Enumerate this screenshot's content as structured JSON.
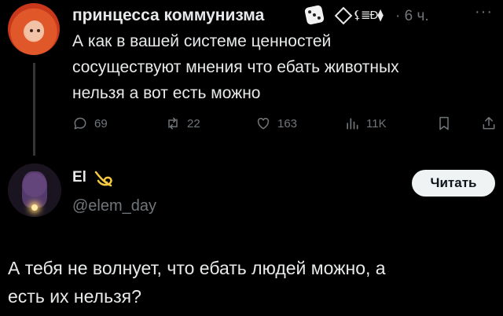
{
  "tweet1": {
    "author_name": "принцесса коммунизма",
    "badge_text": "⚸≣Ð⧫",
    "time": "· 6 ч.",
    "more": "···",
    "text_lines": [
      "А как в вашей системе ценностей",
      "сосуществуют мнения что ебать животных",
      "нельзя а вот есть можно"
    ],
    "stats": {
      "replies": "69",
      "retweets": "22",
      "likes": "163",
      "views": "11K"
    }
  },
  "reply": {
    "author_name": "El",
    "handle": "@elem_day",
    "follow_label": "Читать",
    "text_lines": [
      "А тебя не волнует, что ебать людей можно, а",
      "есть их нельзя?"
    ]
  },
  "icons": {
    "reply": "comment-icon",
    "retweet": "retweet-icon",
    "like": "heart-icon",
    "views": "views-icon",
    "bookmark": "bookmark-icon",
    "share": "share-icon"
  },
  "colors": {
    "background": "#000000",
    "text": "#e7e9ea",
    "muted": "#71767b",
    "button_bg": "#eff3f4"
  }
}
